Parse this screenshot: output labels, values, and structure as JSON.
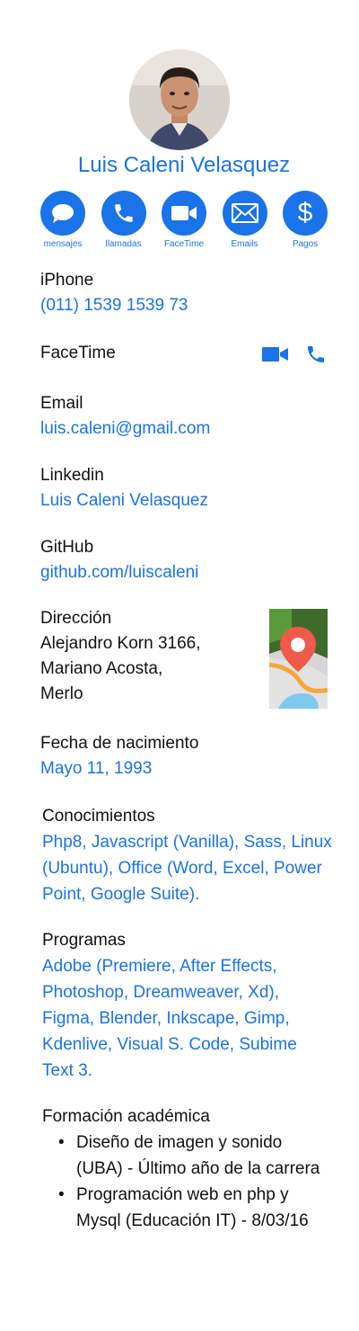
{
  "profile": {
    "name": "Luis Caleni Velasquez"
  },
  "actions": [
    {
      "label": "mensajes",
      "icon": "message-icon"
    },
    {
      "label": "llamadas",
      "icon": "phone-icon"
    },
    {
      "label": "FaceTime",
      "icon": "video-icon"
    },
    {
      "label": "Emails",
      "icon": "mail-icon"
    },
    {
      "label": "Pagos",
      "icon": "dollar-icon"
    }
  ],
  "iphone": {
    "label": "iPhone",
    "value": "(011) 1539 1539 73"
  },
  "facetime": {
    "label": "FaceTime"
  },
  "email": {
    "label": "Email",
    "value": "luis.caleni@gmail.com"
  },
  "linkedin": {
    "label": "Linkedin",
    "value": "Luis Caleni Velasquez"
  },
  "github": {
    "label": "GitHub",
    "value": "github.com/luiscaleni"
  },
  "address": {
    "label": "Dirección",
    "line1": "Alejandro Korn 3166,",
    "line2": "Mariano Acosta,",
    "line3": "Merlo"
  },
  "birthdate": {
    "label": "Fecha de nacimiento",
    "value": "Mayo 11, 1993"
  },
  "skills": {
    "label": "Conocimientos",
    "value": "Php8, Javascript (Vanilla), Sass, Linux (Ubuntu), Office (Word, Excel, Power Point, Google Suite)."
  },
  "programs": {
    "label": "Programas",
    "value": "Adobe (Premiere, After Effects, Photoshop, Dreamweaver, Xd), Figma, Blender, Inkscape, Gimp, Kdenlive, Visual S. Code, Subime Text 3."
  },
  "education": {
    "label": "Formación académica",
    "items": [
      "Diseño de imagen y sonido (UBA) - Último año de la carrera",
      "Programación web en php y Mysql (Educación IT) - 8/03/16"
    ]
  },
  "colors": {
    "accent": "#1a73e8"
  }
}
